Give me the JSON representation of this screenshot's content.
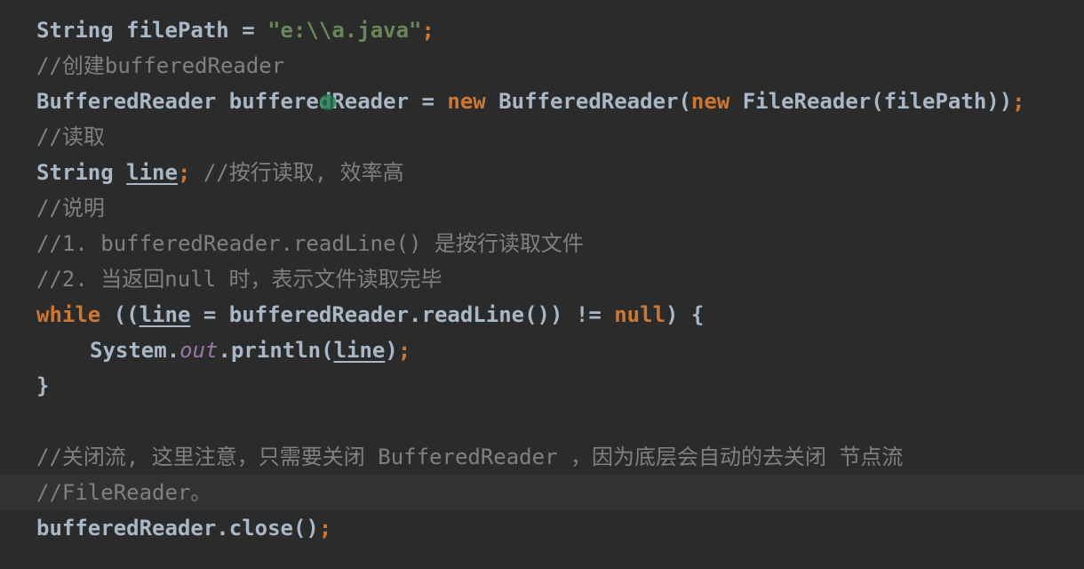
{
  "editor": {
    "lines": [
      {
        "tokens": [
          {
            "t": "String filePath = ",
            "c": "plain"
          },
          {
            "t": "\"e:\\\\a.java\"",
            "c": "str"
          },
          {
            "t": ";",
            "c": "punc"
          }
        ]
      },
      {
        "tokens": [
          {
            "t": "//创建bufferedReader",
            "c": "com"
          }
        ]
      },
      {
        "tokens": [
          {
            "t": "BufferedReader bufferedReader = ",
            "c": "plain"
          },
          {
            "t": "new",
            "c": "kw"
          },
          {
            "t": " BufferedReader(",
            "c": "plain"
          },
          {
            "t": "new",
            "c": "kw"
          },
          {
            "t": " FileReader(filePath))",
            "c": "plain"
          },
          {
            "t": ";",
            "c": "punc"
          }
        ]
      },
      {
        "tokens": [
          {
            "t": "//读取",
            "c": "com"
          }
        ]
      },
      {
        "tokens": [
          {
            "t": "String ",
            "c": "plain"
          },
          {
            "t": "line",
            "c": "var"
          },
          {
            "t": ";",
            "c": "punc"
          },
          {
            "t": " //按行读取, 效率高",
            "c": "com"
          }
        ]
      },
      {
        "tokens": [
          {
            "t": "//说明",
            "c": "com"
          }
        ]
      },
      {
        "tokens": [
          {
            "t": "//1. bufferedReader.readLine() 是按行读取文件",
            "c": "com"
          }
        ]
      },
      {
        "tokens": [
          {
            "t": "//2. 当返回null 时，表示文件读取完毕",
            "c": "com"
          }
        ]
      },
      {
        "tokens": [
          {
            "t": "while",
            "c": "kw"
          },
          {
            "t": " ((",
            "c": "plain"
          },
          {
            "t": "line",
            "c": "var"
          },
          {
            "t": " = bufferedReader.readLine()) != ",
            "c": "plain"
          },
          {
            "t": "null",
            "c": "kw"
          },
          {
            "t": ") {",
            "c": "plain"
          }
        ]
      },
      {
        "indent": true,
        "tokens": [
          {
            "t": "System.",
            "c": "plain"
          },
          {
            "t": "out",
            "c": "field"
          },
          {
            "t": ".println(",
            "c": "plain"
          },
          {
            "t": "line",
            "c": "var"
          },
          {
            "t": ")",
            "c": "plain"
          },
          {
            "t": ";",
            "c": "punc"
          }
        ]
      },
      {
        "tokens": [
          {
            "t": "}",
            "c": "plain"
          }
        ]
      },
      {
        "tokens": []
      },
      {
        "tokens": [
          {
            "t": "//关闭流, 这里注意，只需要关闭 BufferedReader ，因为底层会自动的去关闭 节点流",
            "c": "com"
          }
        ]
      },
      {
        "current": true,
        "tokens": [
          {
            "t": "//FileReader。",
            "c": "com"
          }
        ]
      },
      {
        "tokens": [
          {
            "t": "bufferedReader.close()",
            "c": "plain"
          },
          {
            "t": ";",
            "c": "punc"
          }
        ]
      }
    ]
  },
  "colors": {
    "background": "#2b2b2b",
    "current_line": "#323232",
    "keyword": "#cc7832",
    "string": "#6a8759",
    "comment": "#808080",
    "field": "#9876aa",
    "text": "#a9b7c6"
  }
}
